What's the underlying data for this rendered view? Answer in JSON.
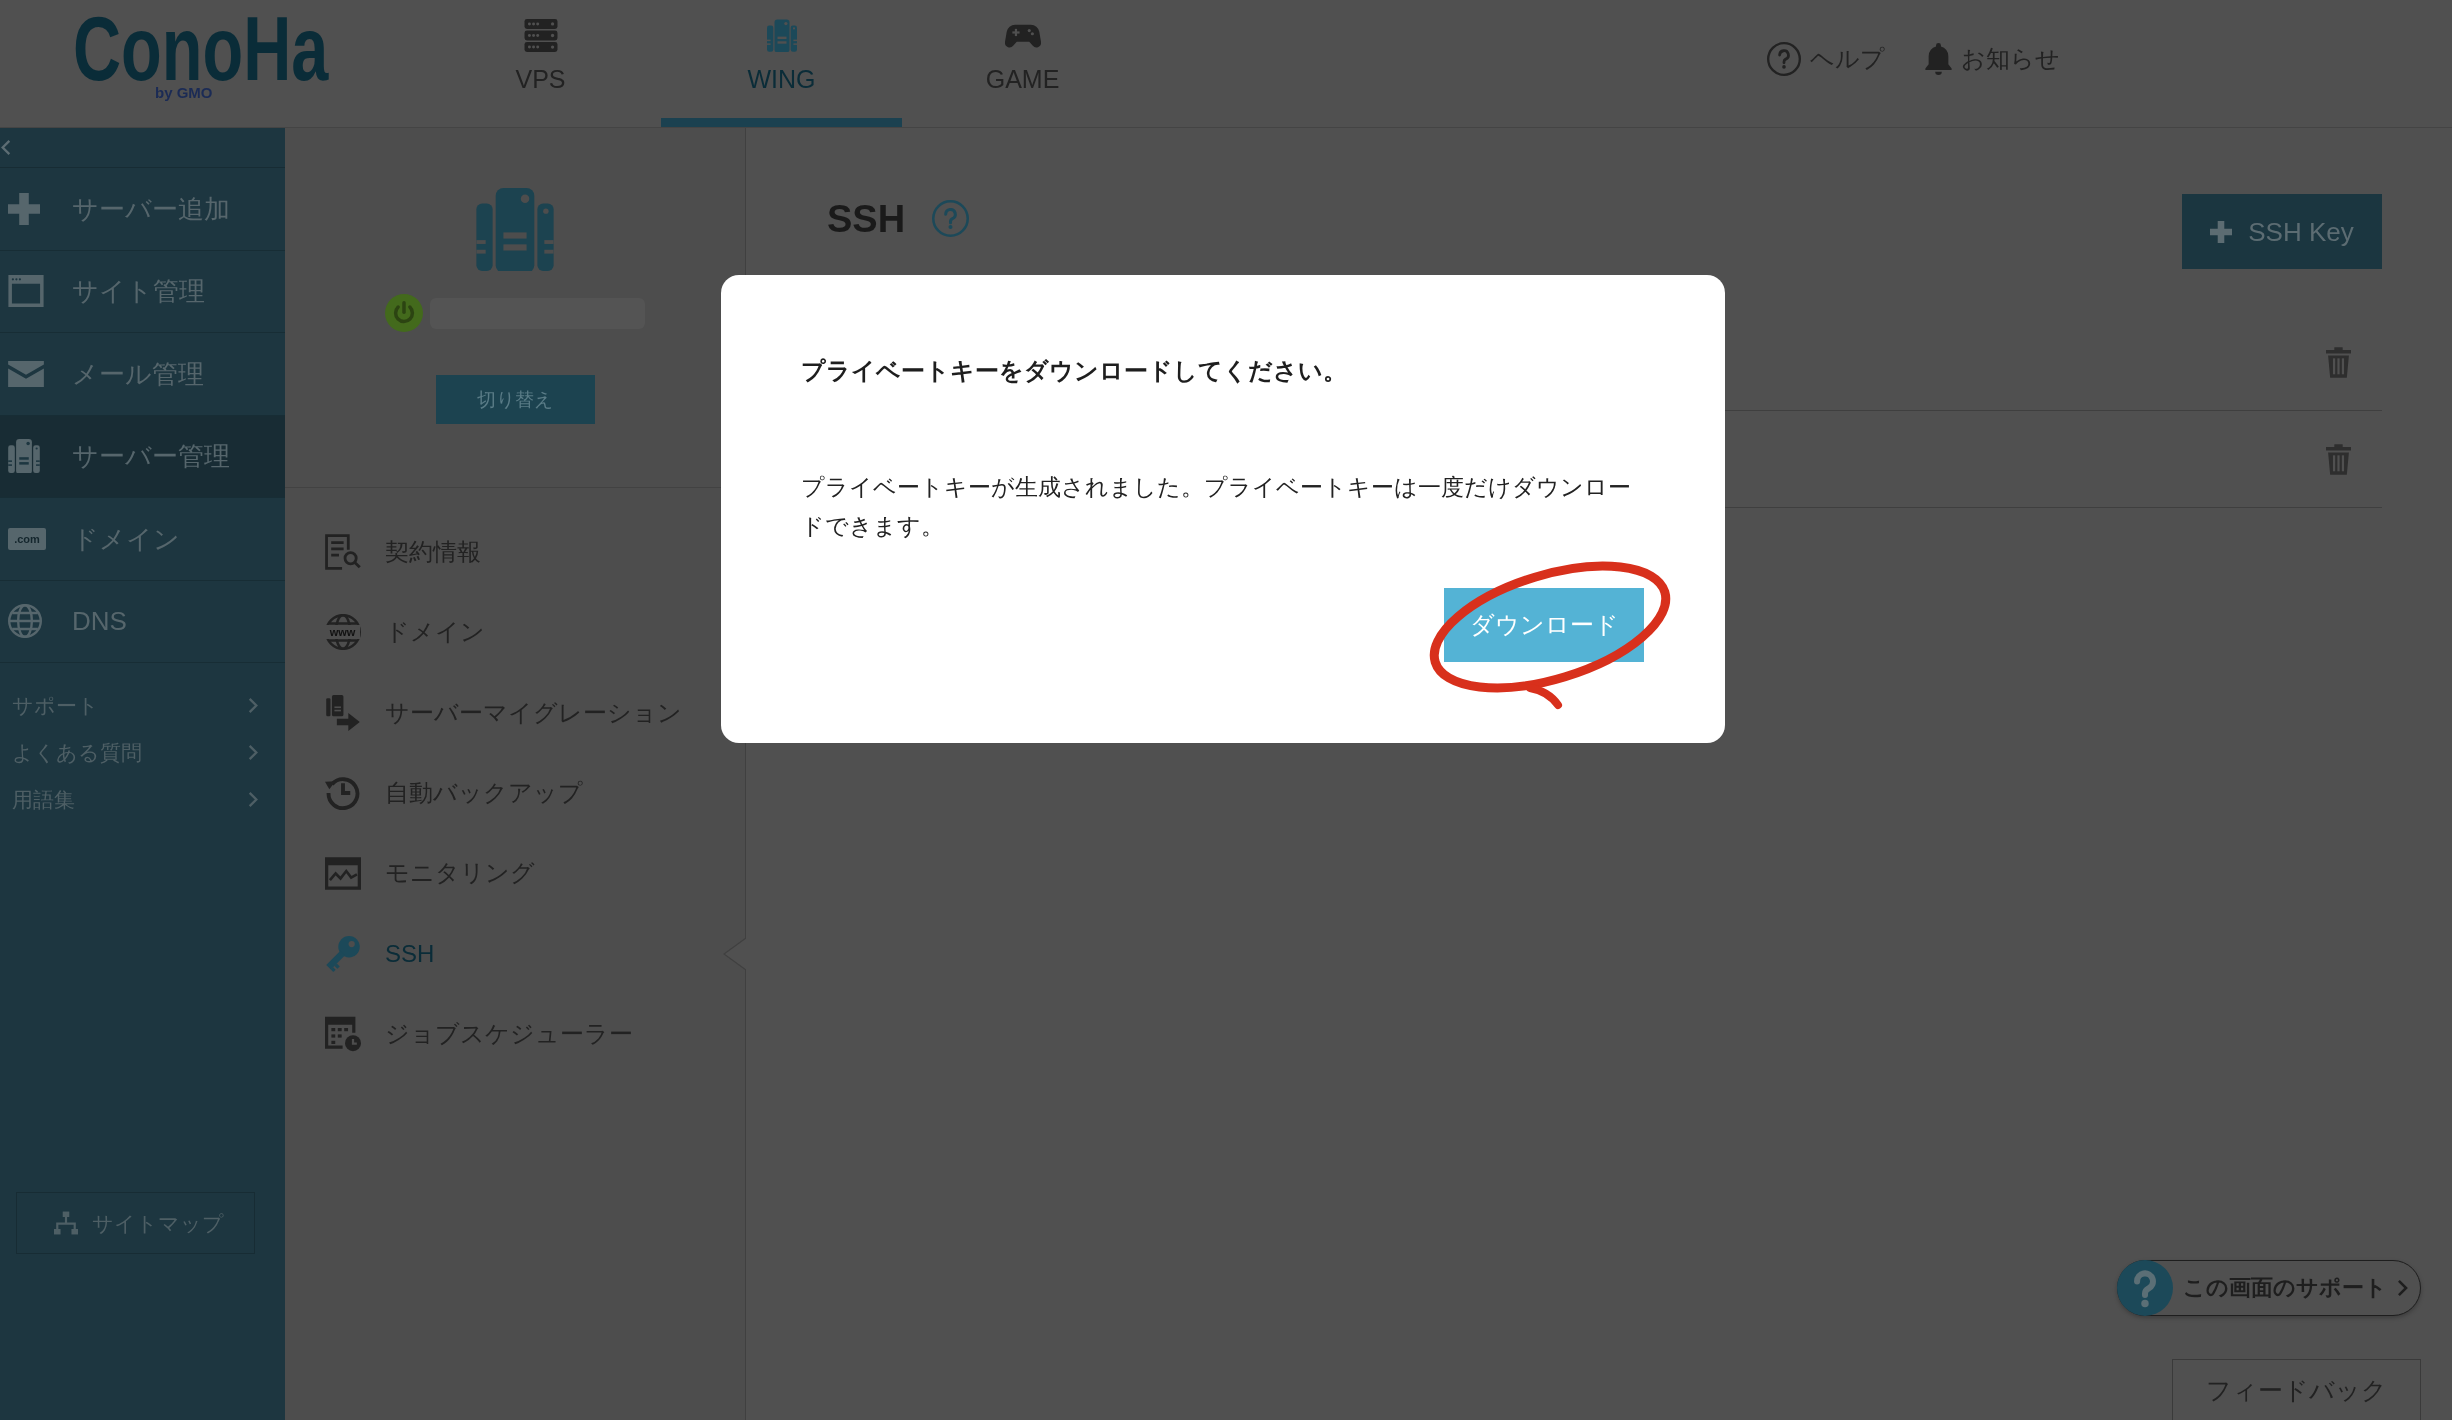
{
  "header": {
    "logo": {
      "wordmark": "ConoHa",
      "tagline": "by GMO"
    },
    "tabs": [
      {
        "label": "VPS",
        "selected": false
      },
      {
        "label": "WING",
        "selected": true
      },
      {
        "label": "GAME",
        "selected": false
      }
    ],
    "links": [
      {
        "label": "ヘルプ"
      },
      {
        "label": "お知らせ"
      }
    ]
  },
  "sidebar": {
    "items": [
      {
        "label": "サーバー追加",
        "selected": false
      },
      {
        "label": "サイト管理",
        "selected": false
      },
      {
        "label": "メール管理",
        "selected": false
      },
      {
        "label": "サーバー管理",
        "selected": true
      },
      {
        "label": "ドメイン",
        "selected": false,
        "icon_text": ".com"
      },
      {
        "label": "DNS",
        "selected": false
      }
    ],
    "links": [
      {
        "label": "サポート"
      },
      {
        "label": "よくある質問"
      },
      {
        "label": "用語集"
      }
    ],
    "sitemap_button": "サイトマップ"
  },
  "server_panel": {
    "running": true,
    "switch_button": "切り替え",
    "menu": [
      {
        "label": "契約情報",
        "selected": false
      },
      {
        "label": "ドメイン",
        "selected": false,
        "icon_text": "www"
      },
      {
        "label": "サーバーマイグレーション",
        "selected": false
      },
      {
        "label": "自動バックアップ",
        "selected": false
      },
      {
        "label": "モニタリング",
        "selected": false
      },
      {
        "label": "SSH",
        "selected": true
      },
      {
        "label": "ジョブスケジューラー",
        "selected": false
      }
    ]
  },
  "main": {
    "title": "SSH",
    "add_button": "SSH Key",
    "key_rows": [
      {
        "deletable": true
      },
      {
        "deletable": true
      }
    ],
    "support_button": "この画面のサポート",
    "feedback_button": "フィードバック"
  },
  "dialog": {
    "title": "プライベートキーをダウンロードしてください。",
    "message": "プライベートキーが生成されました。プライベートキーは一度だけダウンロードできます。",
    "button": "ダウンロード",
    "button_circled": true
  }
}
